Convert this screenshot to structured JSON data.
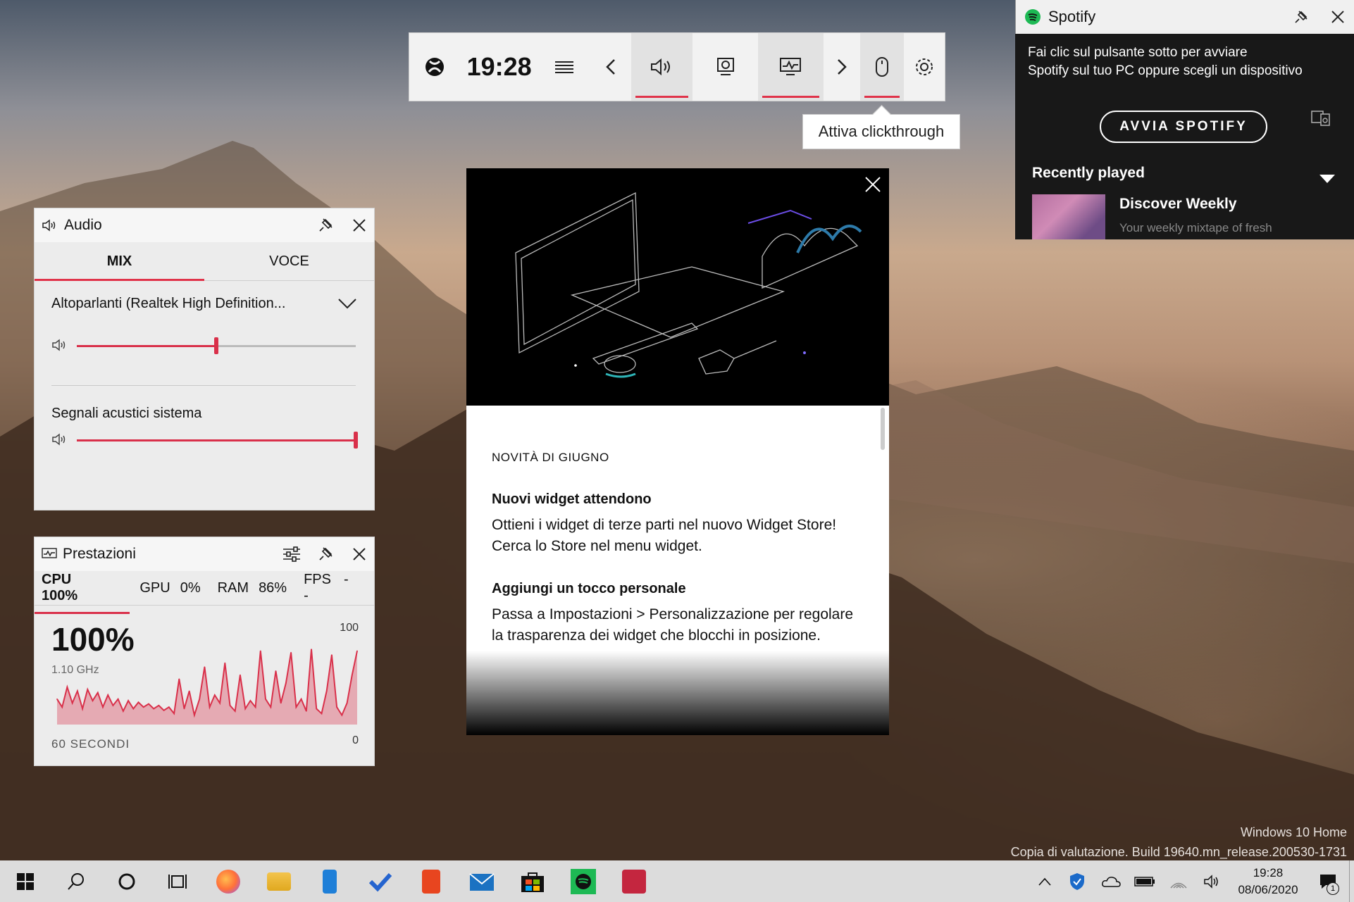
{
  "gamebar": {
    "time": "19:28",
    "tooltip": "Attiva clickthrough"
  },
  "spotify": {
    "title": "Spotify",
    "message_line1": "Fai clic sul pulsante sotto per avviare",
    "message_line2": "Spotify sul tuo PC oppure scegli un dispositivo",
    "start_button": "AVVIA SPOTIFY",
    "recently_played": "Recently played",
    "item_title": "Discover Weekly",
    "item_subtitle": "Your weekly mixtape of fresh"
  },
  "audio": {
    "title": "Audio",
    "tabs": [
      "MIX",
      "VOCE"
    ],
    "device": "Altoparlanti (Realtek High Definition...",
    "device_volume": 0.5,
    "system_sounds_label": "Segnali acustici sistema",
    "system_volume": 1.0
  },
  "performance": {
    "title": "Prestazioni",
    "stats": [
      {
        "label": "CPU",
        "value": "100%"
      },
      {
        "label": "GPU",
        "value": "0%"
      },
      {
        "label": "RAM",
        "value": "86%"
      },
      {
        "label": "FPS",
        "value": "--"
      }
    ],
    "big_value": "100%",
    "frequency": "1.10 GHz",
    "max_label": "100",
    "min_label": "0",
    "duration_label": "60 SECONDI",
    "accent_color": "#d9304a"
  },
  "chart_data": {
    "type": "area",
    "title": "",
    "xlabel": "60 SECONDI",
    "ylabel": "",
    "ylim": [
      0,
      100
    ],
    "values": [
      30,
      20,
      45,
      25,
      40,
      18,
      42,
      28,
      38,
      20,
      35,
      22,
      30,
      15,
      28,
      18,
      26,
      20,
      24,
      18,
      22,
      16,
      20,
      12,
      55,
      18,
      40,
      10,
      30,
      70,
      20,
      35,
      25,
      75,
      22,
      15,
      60,
      18,
      28,
      20,
      90,
      30,
      20,
      65,
      25,
      50,
      88,
      20,
      30,
      15,
      92,
      18,
      12,
      40,
      85,
      20,
      10,
      25,
      60,
      90
    ]
  },
  "news": {
    "section": "NOVITÀ DI GIUGNO",
    "h1": "Nuovi widget attendono",
    "p1": "Ottieni i widget di terze parti nel nuovo Widget Store! Cerca lo Store nel menu widget.",
    "h2": "Aggiungi un tocco personale",
    "p2": "Passa a Impostazioni > Personalizzazione per regolare la trasparenza dei widget che blocchi in posizione."
  },
  "watermark": {
    "line1": "Windows 10 Home",
    "line2": "Copia di valutazione. Build 19640.mn_release.200530-1731"
  },
  "taskbar": {
    "time": "19:28",
    "date": "08/06/2020",
    "notification_count": "1"
  }
}
